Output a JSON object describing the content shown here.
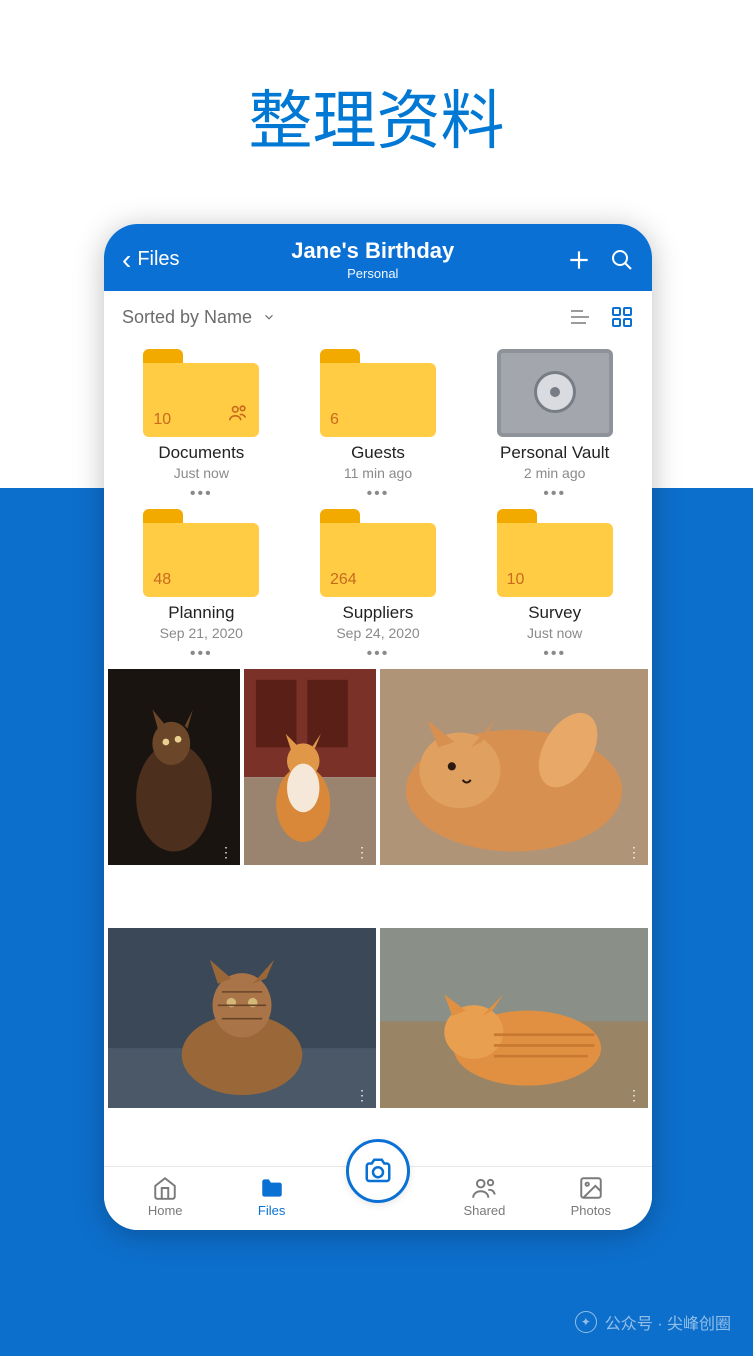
{
  "page_title": "整理资料",
  "header": {
    "back_label": "Files",
    "title": "Jane's Birthday",
    "subtitle": "Personal"
  },
  "sort": {
    "label": "Sorted by Name"
  },
  "folders": [
    {
      "name": "Documents",
      "time": "Just now",
      "count": "10",
      "shared": true,
      "type": "folder"
    },
    {
      "name": "Guests",
      "time": "11 min ago",
      "count": "6",
      "shared": false,
      "type": "folder"
    },
    {
      "name": "Personal Vault",
      "time": "2 min ago",
      "count": "",
      "shared": false,
      "type": "vault"
    },
    {
      "name": "Planning",
      "time": "Sep 21, 2020",
      "count": "48",
      "shared": false,
      "type": "folder"
    },
    {
      "name": "Suppliers",
      "time": "Sep 24, 2020",
      "count": "264",
      "shared": false,
      "type": "folder"
    },
    {
      "name": "Survey",
      "time": "Just now",
      "count": "10",
      "shared": false,
      "type": "folder"
    }
  ],
  "nav": {
    "home": "Home",
    "files": "Files",
    "shared": "Shared",
    "photos": "Photos"
  },
  "watermark": "公众号 · 尖峰创圈"
}
